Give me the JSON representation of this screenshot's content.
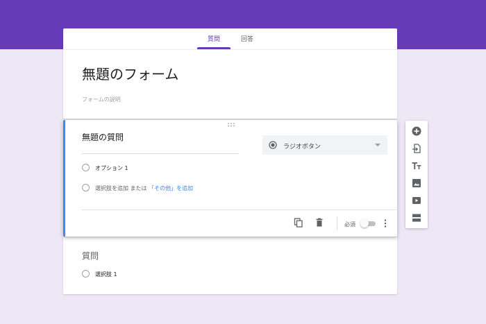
{
  "tabs": [
    {
      "label": "質問",
      "active": true
    },
    {
      "label": "回答",
      "active": false
    }
  ],
  "form": {
    "title": "無題のフォーム",
    "description_placeholder": "フォームの説明"
  },
  "active_question": {
    "title": "無題の質問",
    "type_label": "ラジオボタン",
    "options": [
      {
        "label": "オプション 1"
      }
    ],
    "add_option_text": "選択肢を追加",
    "or_text": "または",
    "add_other_text": "「その他」を追加",
    "required_label": "必須",
    "required": false
  },
  "second_question": {
    "title": "質問",
    "options": [
      {
        "label": "選択肢 1"
      }
    ]
  },
  "toolbar": [
    "add-question-icon",
    "import-questions-icon",
    "add-title-icon",
    "add-image-icon",
    "add-video-icon",
    "add-section-icon"
  ],
  "colors": {
    "header": "#673ab7",
    "background": "#ede7f6",
    "accent": "#4285f4",
    "tab_active": "#673ab7"
  }
}
